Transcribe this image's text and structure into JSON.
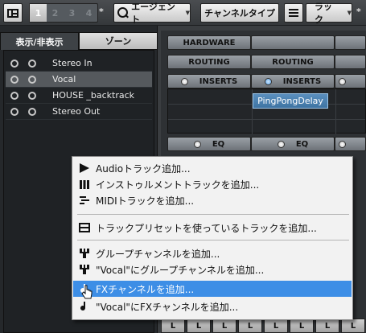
{
  "toolbar": {
    "pages": [
      "1",
      "2",
      "3",
      "4"
    ],
    "pages_suffix": "*",
    "agent_label": "エージェント",
    "channel_type_label": "チャンネルタイプ",
    "rack_label": "ラック",
    "rack_suffix": "*"
  },
  "left_panel": {
    "tabs": [
      "表示/非表示",
      "ゾーン"
    ],
    "tracks": [
      {
        "name": "Stereo In",
        "selected": false
      },
      {
        "name": "Vocal",
        "selected": true
      },
      {
        "name": "HOUSE _backtrack",
        "selected": false
      },
      {
        "name": "Stereo Out",
        "selected": false
      }
    ]
  },
  "mixer": {
    "hardware_label": "HARDWARE",
    "routing_labels": [
      "ROUTING",
      "ROUTING"
    ],
    "inserts_labels": [
      "INSERTS",
      "INSERTS"
    ],
    "plugin": "PingPongDelay",
    "eq_labels": [
      "EQ",
      "EQ"
    ],
    "bottom_buttons": [
      "L",
      "L",
      "L",
      "L",
      "L",
      "L",
      "L",
      "L"
    ]
  },
  "context_menu": {
    "items": [
      {
        "label": "Audioトラック追加...",
        "icon": "audio-track-icon"
      },
      {
        "label": "インストゥルメントトラックを追加...",
        "icon": "instrument-track-icon"
      },
      {
        "label": "MIDIトラックを追加...",
        "icon": "midi-track-icon"
      },
      {
        "label": "トラックプリセットを使っているトラックを追加...",
        "icon": "track-preset-icon"
      },
      {
        "label": "グループチャンネルを追加...",
        "icon": "group-channel-icon"
      },
      {
        "label": "\"Vocal\"にグループチャンネルを追加...",
        "icon": "group-channel-icon"
      },
      {
        "label": "FXチャンネルを追加...",
        "icon": "fx-channel-icon"
      },
      {
        "label": "\"Vocal\"にFXチャンネルを追加...",
        "icon": "fx-channel-icon"
      }
    ],
    "highlighted_index": 6
  },
  "colors": {
    "highlight": "#3d8ee6",
    "plugin_slot": "#4a80b0"
  }
}
